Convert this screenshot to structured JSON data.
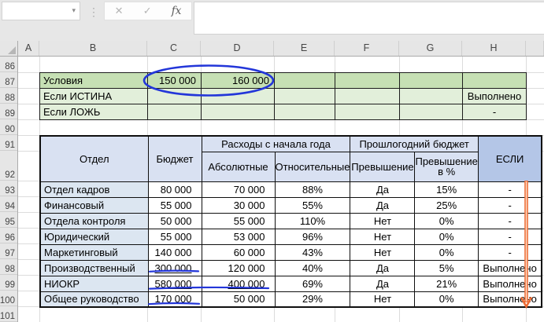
{
  "chrome": {
    "name_box": "",
    "formula_bar": ""
  },
  "icons": {
    "dropdown": "▾",
    "dots": "⋮",
    "cancel": "✕",
    "enter": "✓",
    "fx": "fx"
  },
  "grid": {
    "column_letters": [
      "A",
      "B",
      "C",
      "D",
      "E",
      "F",
      "G",
      "H"
    ],
    "row_numbers": [
      86,
      87,
      88,
      89,
      90,
      91,
      92,
      93,
      94,
      95,
      96,
      97,
      98,
      99,
      100,
      101
    ]
  },
  "conditions": {
    "rows": [
      {
        "label": "Условия",
        "c": "150 000",
        "d": "160 000",
        "h": ""
      },
      {
        "label": "Если ИСТИНА",
        "c": "",
        "d": "",
        "h": "Выполнено"
      },
      {
        "label": "Если ЛОЖЬ",
        "c": "",
        "d": "",
        "h": "-"
      }
    ]
  },
  "table": {
    "headers": {
      "dept": "Отдел",
      "budget": "Бюджет",
      "expenses_group": "Расходы с начала года",
      "absolute": "Абсолютные",
      "relative": "Относительные",
      "lastyear_group": "Прошлогодний бюджет",
      "exceed": "Превышение",
      "exceed_pct": "Превышение в %",
      "if": "ЕСЛИ"
    },
    "rows": [
      {
        "dept": "Отдел кадров",
        "budget": "80 000",
        "abs": "70 000",
        "rel": "88%",
        "exceed": "Да",
        "exceed_pct": "15%",
        "if": "-"
      },
      {
        "dept": "Финансовый",
        "budget": "55 000",
        "abs": "30 000",
        "rel": "55%",
        "exceed": "Да",
        "exceed_pct": "25%",
        "if": "-"
      },
      {
        "dept": "Отдела контроля",
        "budget": "50 000",
        "abs": "55 000",
        "rel": "110%",
        "exceed": "Нет",
        "exceed_pct": "0%",
        "if": "-"
      },
      {
        "dept": "Юридический",
        "budget": "55 000",
        "abs": "53 000",
        "rel": "96%",
        "exceed": "Нет",
        "exceed_pct": "0%",
        "if": "-"
      },
      {
        "dept": "Маркетинговый",
        "budget": "140 000",
        "abs": "60 000",
        "rel": "43%",
        "exceed": "Нет",
        "exceed_pct": "0%",
        "if": "-"
      },
      {
        "dept": "Производственный",
        "budget": "300 000",
        "abs": "120 000",
        "rel": "40%",
        "exceed": "Да",
        "exceed_pct": "5%",
        "if": "Выполнено",
        "budget_u": true
      },
      {
        "dept": "НИОКР",
        "budget": "580 000",
        "abs": "400 000",
        "rel": "69%",
        "exceed": "Да",
        "exceed_pct": "21%",
        "if": "Выполнено",
        "budget_u": true,
        "abs_u": true
      },
      {
        "dept": "Общее руководство",
        "budget": "170 000",
        "abs": "50 000",
        "rel": "29%",
        "exceed": "Нет",
        "exceed_pct": "0%",
        "if": "Выполнено",
        "budget_u": true
      }
    ]
  },
  "annotations": {
    "ellipse_color": "#2336d9",
    "underline_color": "#2336d9",
    "arrow_color": "#ed6b33",
    "arrow_inner_color": "#fbd9c4",
    "underlined_values": [
      "300 000",
      "580 000",
      "400 000",
      "170 000"
    ]
  },
  "colors": {
    "condition_header_green": "#c6e0b4",
    "condition_light_green": "#e2efda",
    "table_header_blue": "#d9e1f2",
    "if_header_blue": "#b4c6e7",
    "dept_cell_blue": "#dce6f1",
    "chrome_gray": "#e7e7e7"
  }
}
